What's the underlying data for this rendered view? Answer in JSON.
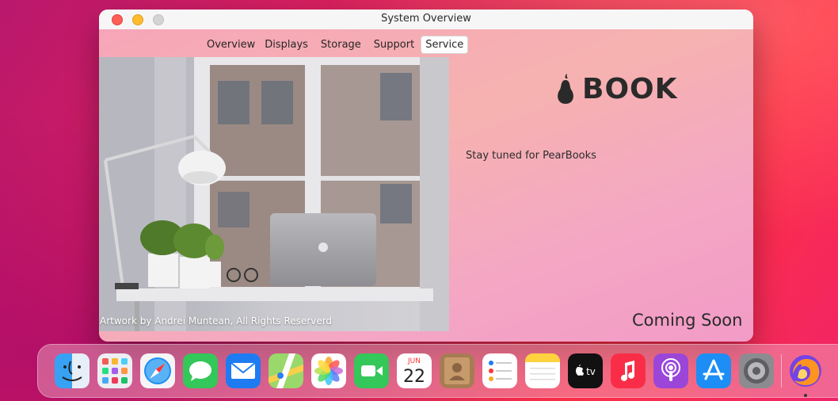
{
  "window": {
    "title": "System Overview"
  },
  "tabs": [
    {
      "label": "Overview",
      "active": false
    },
    {
      "label": "Displays",
      "active": false
    },
    {
      "label": "Storage",
      "active": false
    },
    {
      "label": "Support",
      "active": false
    },
    {
      "label": "Service",
      "active": true
    }
  ],
  "photo": {
    "credit": "Artwork by Andrei Muntean, All Rights Reserverd"
  },
  "brand": {
    "logo_icon": "pear-icon",
    "name": "BOOK"
  },
  "tagline": "Stay tuned for PearBooks",
  "coming_soon": "Coming Soon",
  "calendar_icon": {
    "month": "JUN",
    "day": "22"
  },
  "dock": {
    "apps": [
      "finder-icon",
      "launchpad-icon",
      "safari-icon",
      "messages-icon",
      "mail-icon",
      "maps-icon",
      "photos-icon",
      "facetime-icon",
      "calendar-icon",
      "contacts-icon",
      "reminders-icon",
      "notes-icon",
      "apple-tv-icon",
      "music-icon",
      "podcasts-icon",
      "app-store-icon",
      "system-preferences-icon",
      "firefox-icon"
    ],
    "tv_label": "tv"
  },
  "colors": {
    "accent_pink": "#f2a9bf",
    "close": "#fe5f57",
    "minimize": "#febc2e",
    "zoom_disabled": "#d5d4d4"
  }
}
